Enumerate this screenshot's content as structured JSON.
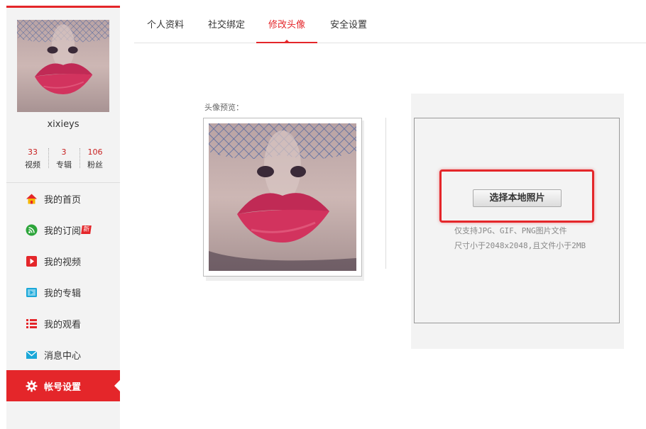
{
  "sidebar": {
    "username": "xixieys",
    "stats": [
      {
        "value": "33",
        "label": "视频"
      },
      {
        "value": "3",
        "label": "专辑"
      },
      {
        "value": "106",
        "label": "粉丝"
      }
    ],
    "nav": [
      {
        "label": "我的首页",
        "icon": "home-icon"
      },
      {
        "label": "我的订阅",
        "icon": "rss-icon",
        "badge": "新"
      },
      {
        "label": "我的视频",
        "icon": "video-play-icon"
      },
      {
        "label": "我的专辑",
        "icon": "album-icon"
      },
      {
        "label": "我的观看",
        "icon": "watch-list-icon"
      },
      {
        "label": "消息中心",
        "icon": "mail-icon"
      },
      {
        "label": "帐号设置",
        "icon": "gear-icon",
        "active": true
      }
    ]
  },
  "tabs": [
    {
      "label": "个人资料"
    },
    {
      "label": "社交绑定"
    },
    {
      "label": "修改头像",
      "active": true
    },
    {
      "label": "安全设置"
    }
  ],
  "preview": {
    "label": "头像预览："
  },
  "upload": {
    "button_label": "选择本地照片",
    "hint_line1": "仅支持JPG、GIF、PNG图片文件",
    "hint_line2": "尺寸小于2048x2048,且文件小于2MB"
  },
  "colors": {
    "accent": "#e4262a",
    "sidebar_bg": "#f3f3f3"
  }
}
